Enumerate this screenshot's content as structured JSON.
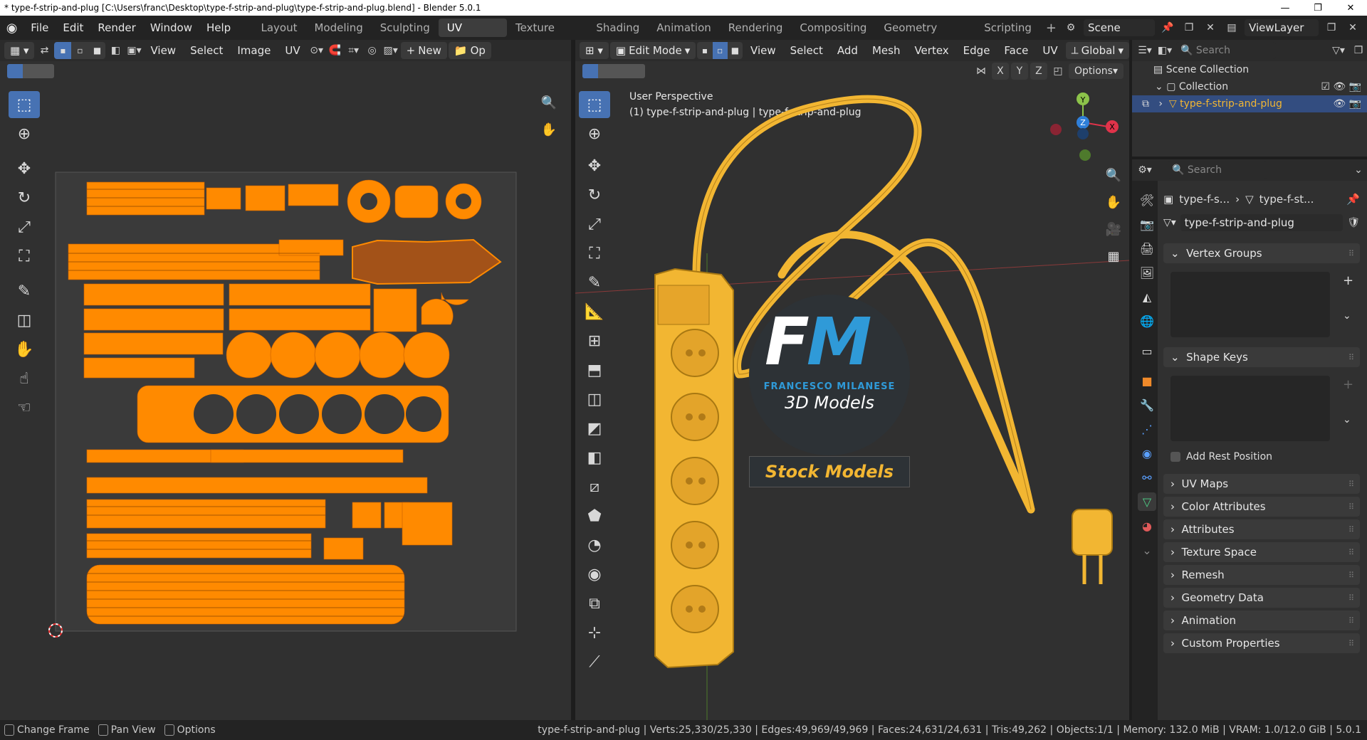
{
  "window": {
    "title": "* type-f-strip-and-plug [C:\\Users\\franc\\Desktop\\type-f-strip-and-plug\\type-f-strip-and-plug.blend] - Blender 5.0.1",
    "minimize": "—",
    "maximize": "❐",
    "close": "✕"
  },
  "menu": {
    "items": [
      "File",
      "Edit",
      "Render",
      "Window",
      "Help"
    ]
  },
  "workspaces": [
    {
      "label": "Layout",
      "active": false
    },
    {
      "label": "Modeling",
      "active": false
    },
    {
      "label": "Sculpting",
      "active": false
    },
    {
      "label": "UV Editing",
      "active": true
    },
    {
      "label": "Texture Paint",
      "active": false
    },
    {
      "label": "Shading",
      "active": false
    },
    {
      "label": "Animation",
      "active": false
    },
    {
      "label": "Rendering",
      "active": false
    },
    {
      "label": "Compositing",
      "active": false
    },
    {
      "label": "Geometry Nodes",
      "active": false
    },
    {
      "label": "Scripting",
      "active": false
    }
  ],
  "scene": {
    "name": "Scene",
    "view_layer": "ViewLayer"
  },
  "uv_editor": {
    "menus": [
      "View",
      "Select",
      "Image",
      "UV"
    ],
    "new_label": "New",
    "open_label": "Op"
  },
  "viewport": {
    "mode": "Edit Mode",
    "menus": [
      "View",
      "Select",
      "Add",
      "Mesh",
      "Vertex",
      "Edge",
      "Face",
      "UV"
    ],
    "orientation": "Global",
    "axes": [
      "X",
      "Y",
      "Z"
    ],
    "options_label": "Options",
    "perspective_label": "User Perspective",
    "object_label": "(1) type-f-strip-and-plug | type-f-strip-and-plug",
    "watermark": {
      "initials": "FM",
      "company": "FRANCESCO MILANESE",
      "subtitle": "3D Models",
      "banner": "Stock Models"
    },
    "gizmo": {
      "y": "Y",
      "z": "Z",
      "x": "X"
    }
  },
  "outliner": {
    "search_placeholder": "Search",
    "scene_collection": "Scene Collection",
    "collection": "Collection",
    "object": "type-f-strip-and-plug"
  },
  "properties": {
    "search_placeholder": "Search",
    "breadcrumb": [
      "type-f-s...",
      "type-f-st..."
    ],
    "mesh_name": "type-f-strip-and-plug",
    "vertex_groups": "Vertex Groups",
    "shape_keys": "Shape Keys",
    "add_rest_position": "Add Rest Position",
    "panels": [
      "UV Maps",
      "Color Attributes",
      "Attributes",
      "Texture Space",
      "Remesh",
      "Geometry Data",
      "Animation",
      "Custom Properties"
    ]
  },
  "status": {
    "hints": [
      "Change Frame",
      "Pan View",
      "Options"
    ],
    "stats": "type-f-strip-and-plug | Verts:25,330/25,330 | Edges:49,969/49,969 | Faces:24,631/24,631 | Tris:49,262 | Objects:1/1 | Memory: 132.0 MiB | VRAM: 1.0/12.0 GiB | 5.0.1"
  },
  "colors": {
    "accent": "#4772b3",
    "uv_orange": "#ff8a00",
    "wire_yellow": "#f2b632",
    "background": "#303030",
    "watermark_blue": "#2f9ad8"
  }
}
